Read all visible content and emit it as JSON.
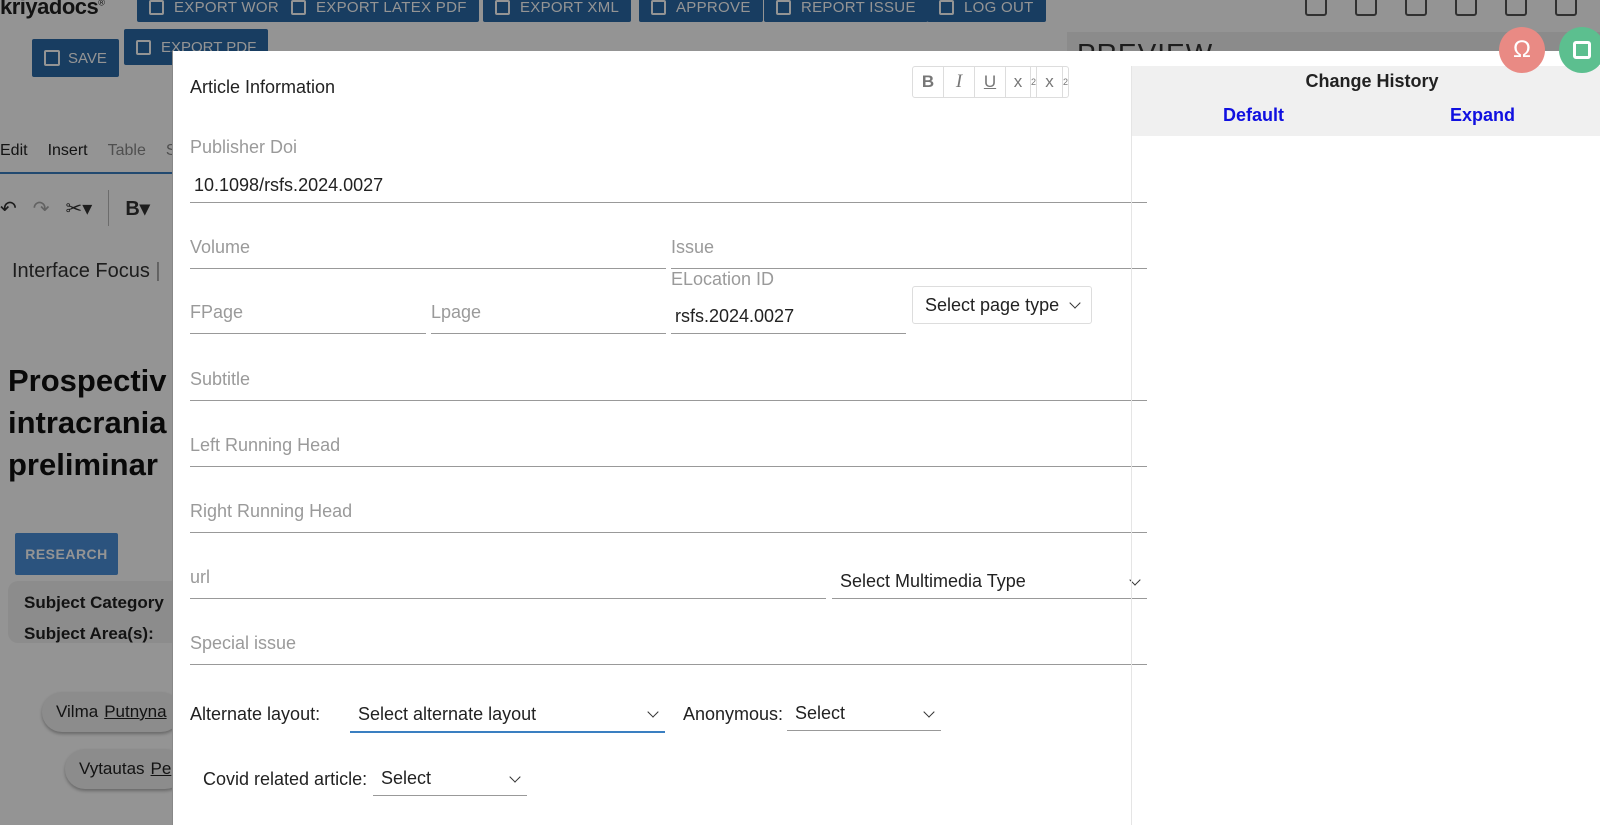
{
  "app": {
    "logo": "kriyadocs",
    "logo_mark": "®"
  },
  "top_toolbar": {
    "buttons": [
      "EXPORT WORD",
      "EXPORT LATEX PDF",
      "EXPORT XML",
      "APPROVE",
      "REPORT ISSUE",
      "LOG OUT"
    ],
    "save": "SAVE",
    "export_pdf": "EXPORT PDF"
  },
  "preview": {
    "title": "PREVIEW"
  },
  "editor": {
    "menu": [
      "Edit",
      "Insert",
      "Table",
      "S"
    ],
    "journal": "Interface Focus",
    "journal_sep": "|",
    "title_lines": [
      "Prospectiv",
      "intracrania",
      "preliminar"
    ],
    "article_type": "RESEARCH",
    "subject_category": "Subject Category",
    "subject_areas": "Subject Area(s):",
    "authors": [
      {
        "given": "Vilma",
        "surname": "Putnyna"
      },
      {
        "given": "Vytautas",
        "surname": "Pe"
      }
    ]
  },
  "modal": {
    "title": "Article Information",
    "format_buttons": {
      "bold": "B",
      "italic": "I",
      "underline": "U",
      "superscript": "x",
      "superscript_mark": "2",
      "subscript": "x",
      "subscript_mark": "2"
    },
    "publisher_doi": {
      "label": "Publisher Doi",
      "value": "10.1098/rsfs.2024.0027"
    },
    "volume": {
      "placeholder": "Volume"
    },
    "issue": {
      "placeholder": "Issue"
    },
    "fpage": {
      "placeholder": "FPage"
    },
    "lpage": {
      "placeholder": "Lpage"
    },
    "elocation": {
      "label": "ELocation ID",
      "value": "rsfs.2024.0027"
    },
    "page_type": {
      "selected": "Select page type"
    },
    "subtitle": {
      "placeholder": "Subtitle"
    },
    "left_running_head": {
      "placeholder": "Left Running Head"
    },
    "right_running_head": {
      "placeholder": "Right Running Head"
    },
    "url": {
      "placeholder": "url"
    },
    "multimedia_type": {
      "selected": "Select Multimedia Type"
    },
    "special_issue": {
      "placeholder": "Special issue"
    },
    "alternate_layout": {
      "label": "Alternate layout:",
      "selected": "Select alternate layout"
    },
    "anonymous": {
      "label": "Anonymous:",
      "selected": "Select"
    },
    "covid": {
      "label": "Covid related article:",
      "selected": "Select"
    }
  },
  "history": {
    "title": "Change History",
    "default_link": "Default",
    "expand_link": "Expand"
  },
  "fabs": {
    "special_chars_glyph": "Ω"
  },
  "colors": {
    "primary_button": "#2a6aa8",
    "link_blue": "#1010e0",
    "fab_omega": "#e98a84",
    "fab_save": "#5cbf8f",
    "active_underline": "#3a7fc1"
  }
}
